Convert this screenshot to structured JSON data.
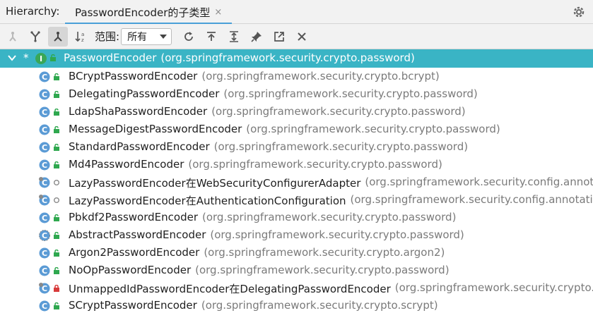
{
  "header": {
    "label": "Hierarchy:",
    "tab_label": "PasswordEncoder的子类型",
    "tab_close": "×"
  },
  "toolbar": {
    "scope_label": "范围:",
    "scope_value": "所有"
  },
  "root": {
    "name": "PasswordEncoder",
    "package": "(org.springframework.security.crypto.password)",
    "star": "*"
  },
  "children": [
    {
      "name": "BCryptPasswordEncoder",
      "package": "(org.springframework.security.crypto.bcrypt)",
      "kind": "class",
      "visibility": "public"
    },
    {
      "name": "DelegatingPasswordEncoder",
      "package": "(org.springframework.security.crypto.password)",
      "kind": "class",
      "visibility": "public"
    },
    {
      "name": "LdapShaPasswordEncoder",
      "package": "(org.springframework.security.crypto.password)",
      "kind": "class",
      "visibility": "public"
    },
    {
      "name": "MessageDigestPasswordEncoder",
      "package": "(org.springframework.security.crypto.password)",
      "kind": "class",
      "visibility": "public"
    },
    {
      "name": "StandardPasswordEncoder",
      "package": "(org.springframework.security.crypto.password)",
      "kind": "class",
      "visibility": "public"
    },
    {
      "name": "Md4PasswordEncoder",
      "package": "(org.springframework.security.crypto.password)",
      "kind": "class",
      "visibility": "public"
    },
    {
      "name": "LazyPasswordEncoder在WebSecurityConfigurerAdapter",
      "package": "(org.springframework.security.config.annotati",
      "kind": "inner",
      "visibility": "package"
    },
    {
      "name": "LazyPasswordEncoder在AuthenticationConfiguration",
      "package": "(org.springframework.security.config.annotation.",
      "kind": "inner",
      "visibility": "package"
    },
    {
      "name": "Pbkdf2PasswordEncoder",
      "package": "(org.springframework.security.crypto.password)",
      "kind": "class",
      "visibility": "public"
    },
    {
      "name": "AbstractPasswordEncoder",
      "package": "(org.springframework.security.crypto.password)",
      "kind": "abstract",
      "visibility": "public"
    },
    {
      "name": "Argon2PasswordEncoder",
      "package": "(org.springframework.security.crypto.argon2)",
      "kind": "class",
      "visibility": "public"
    },
    {
      "name": "NoOpPasswordEncoder",
      "package": "(org.springframework.security.crypto.password)",
      "kind": "class",
      "visibility": "public"
    },
    {
      "name": "UnmappedIdPasswordEncoder在DelegatingPasswordEncoder",
      "package": "(org.springframework.security.crypto.pa",
      "kind": "inner",
      "visibility": "private"
    },
    {
      "name": "SCryptPasswordEncoder",
      "package": "(org.springframework.security.crypto.scrypt)",
      "kind": "class",
      "visibility": "public"
    }
  ],
  "colors": {
    "selection": "#3ab4c5",
    "tab_underline": "#4a9fd8",
    "class_icon": "#5b9bd5",
    "interface_icon": "#3aa757",
    "public_lock": "#2fa84f",
    "private_lock": "#d83b3b"
  }
}
